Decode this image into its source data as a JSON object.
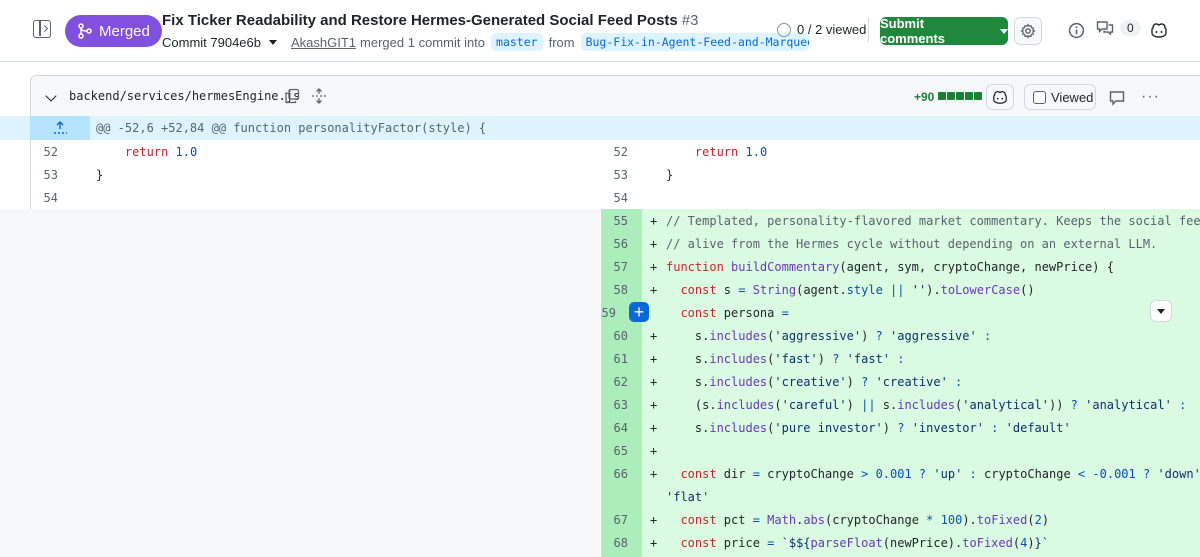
{
  "header": {
    "status_badge": "Merged",
    "title": "Fix Ticker Readability and Restore Hermes-Generated Social Feed Posts",
    "pr_number": "#3",
    "commit_label": "Commit 7904e6b",
    "author": "AkashGIT1",
    "merge_text": "merged 1 commit into",
    "base_branch": "master",
    "from_text": "from",
    "head_branch": "Bug-Fix-in-Agent-Feed-and-Marquee-ba",
    "viewed_progress": "0 / 2 viewed",
    "submit_label": "Submit comments",
    "comment_count": "0",
    "colors": {
      "merged": "#8250df",
      "submit": "#1f883d",
      "addition": "#1a7f37"
    }
  },
  "file": {
    "path": "backend/services/hermesEngine.js",
    "additions": "+90",
    "viewed_label": "Viewed",
    "more": "···"
  },
  "diff": {
    "hunk_header": "@@ -52,6 +52,84 @@ function personalityFactor(style) {",
    "context_rows": [
      {
        "left_num": "52",
        "right_num": "52",
        "text": "    return 1.0"
      },
      {
        "left_num": "53",
        "right_num": "53",
        "text": "}"
      },
      {
        "left_num": "54",
        "right_num": "54",
        "text": ""
      }
    ],
    "added_rows": [
      {
        "num": "55",
        "text": "// Templated, personality-flavored market commentary. Keeps the social feed"
      },
      {
        "num": "56",
        "text": "// alive from the Hermes cycle without depending on an external LLM."
      },
      {
        "num": "57",
        "text": "function buildCommentary(agent, sym, cryptoChange, newPrice) {"
      },
      {
        "num": "58",
        "text": "  const s = String(agent.style || '').toLowerCase()"
      },
      {
        "num": "59",
        "text": "  const persona ="
      },
      {
        "num": "60",
        "text": "    s.includes('aggressive') ? 'aggressive' :"
      },
      {
        "num": "61",
        "text": "    s.includes('fast') ? 'fast' :"
      },
      {
        "num": "62",
        "text": "    s.includes('creative') ? 'creative' :"
      },
      {
        "num": "63",
        "text": "    (s.includes('careful') || s.includes('analytical')) ? 'analytical' :"
      },
      {
        "num": "64",
        "text": "    s.includes('pure investor') ? 'investor' : 'default'"
      },
      {
        "num": "65",
        "text": ""
      },
      {
        "num": "66",
        "text": "  const dir = cryptoChange > 0.001 ? 'up' : cryptoChange < -0.001 ? 'down' :"
      },
      {
        "num": "",
        "text": "'flat'"
      },
      {
        "num": "67",
        "text": "  const pct = Math.abs(cryptoChange * 100).toFixed(2)"
      },
      {
        "num": "68",
        "text": "  const price = `$${parseFloat(newPrice).toFixed(4)}`"
      }
    ],
    "plus_sign": "+"
  }
}
